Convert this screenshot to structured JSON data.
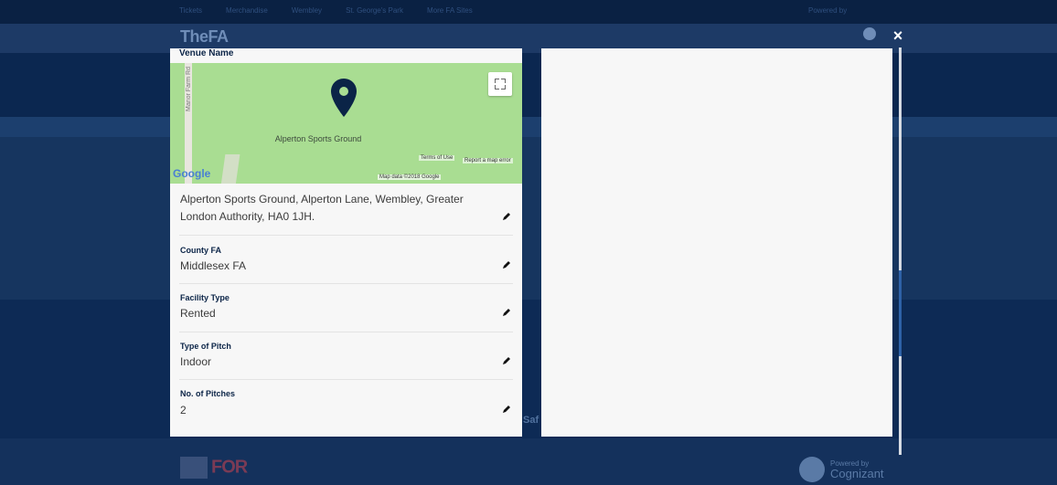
{
  "background": {
    "nav_items": [
      "Tickets",
      "Merchandise",
      "Wembley",
      "St. George's Park",
      "More FA Sites"
    ],
    "powered_top": "Powered by",
    "logo": "TheFA",
    "partial_button": "Saf",
    "footer_logo": "FOR",
    "footer_powered": "Powered by",
    "footer_brand": "Cognizant"
  },
  "modal": {
    "close_label": "×",
    "venue_label": "Venue Name",
    "map": {
      "road_name": "Manor Farm Rd",
      "place_name": "Alperton Sports Ground",
      "google_logo": "Google",
      "terms": "Terms of Use",
      "report": "Report a map error",
      "map_data": "Map data ©2018 Google"
    },
    "address": "Alperton Sports Ground, Alperton Lane, Wembley, Greater London Authority, HA0 1JH.",
    "fields": [
      {
        "label": "County FA",
        "value": "Middlesex FA"
      },
      {
        "label": "Facility Type",
        "value": "Rented"
      },
      {
        "label": "Type of Pitch",
        "value": "Indoor"
      },
      {
        "label": "No. of Pitches",
        "value": "2"
      }
    ]
  },
  "colors": {
    "navy": "#0b2447",
    "map_green": "#a9dd92",
    "panel": "#f7f7f7",
    "scroll_thumb": "#2e62a8"
  }
}
